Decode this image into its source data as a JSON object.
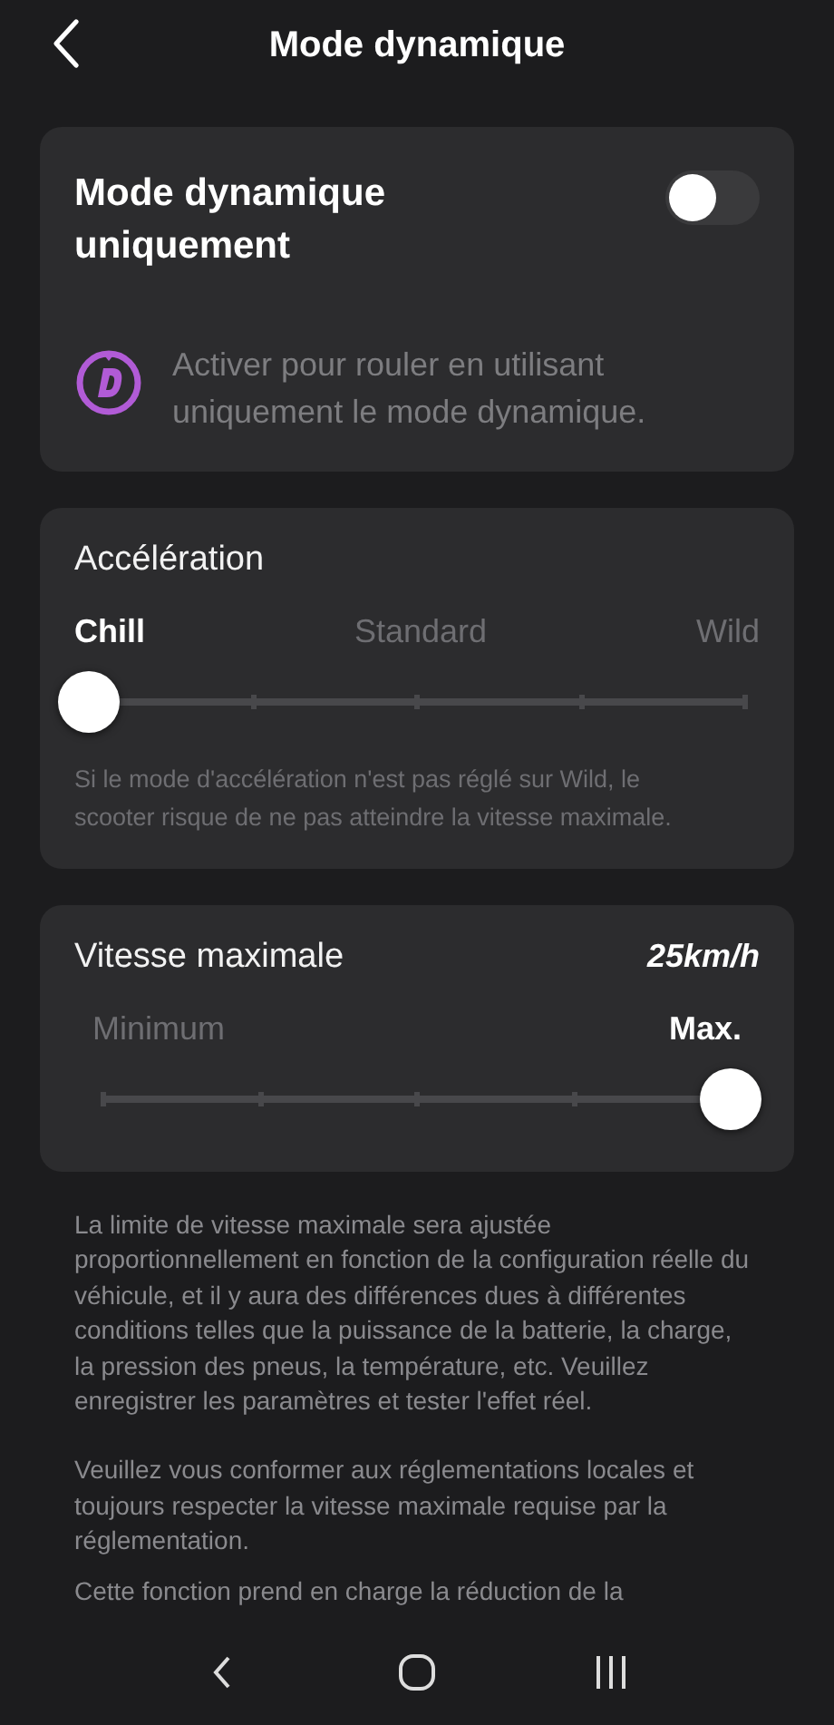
{
  "header": {
    "title": "Mode dynamique"
  },
  "dynamic_card": {
    "title": "Mode dynamique uniquement",
    "toggle_on": false,
    "description": "Activer pour rouler en utilisant uniquement le mode dynamique."
  },
  "acceleration": {
    "title": "Accélération",
    "options": [
      {
        "label": "Chill",
        "selected": true
      },
      {
        "label": "Standard",
        "selected": false
      },
      {
        "label": "Wild",
        "selected": false
      }
    ],
    "level": 0,
    "note": "Si le mode d'accélération n'est pas réglé sur Wild, le scooter risque de ne pas atteindre la vitesse maximale."
  },
  "max_speed": {
    "title": "Vitesse maximale",
    "value": "25km/h",
    "options": [
      {
        "label": "Minimum",
        "selected": false
      },
      {
        "label": "Max.",
        "selected": true
      }
    ],
    "level": 1
  },
  "notes": [
    "La limite de vitesse maximale sera ajustée proportionnellement en fonction de la configuration réelle du véhicule, et il y aura des différences dues à différentes conditions telles que la puissance de la batterie, la charge, la pression des pneus, la température, etc. Veuillez enregistrer les paramètres et tester l'effet réel.",
    "Veuillez vous conformer aux réglementations locales et toujours respecter la vitesse maximale requise par la réglementation.",
    "Cette fonction prend en charge la réduction de la"
  ]
}
